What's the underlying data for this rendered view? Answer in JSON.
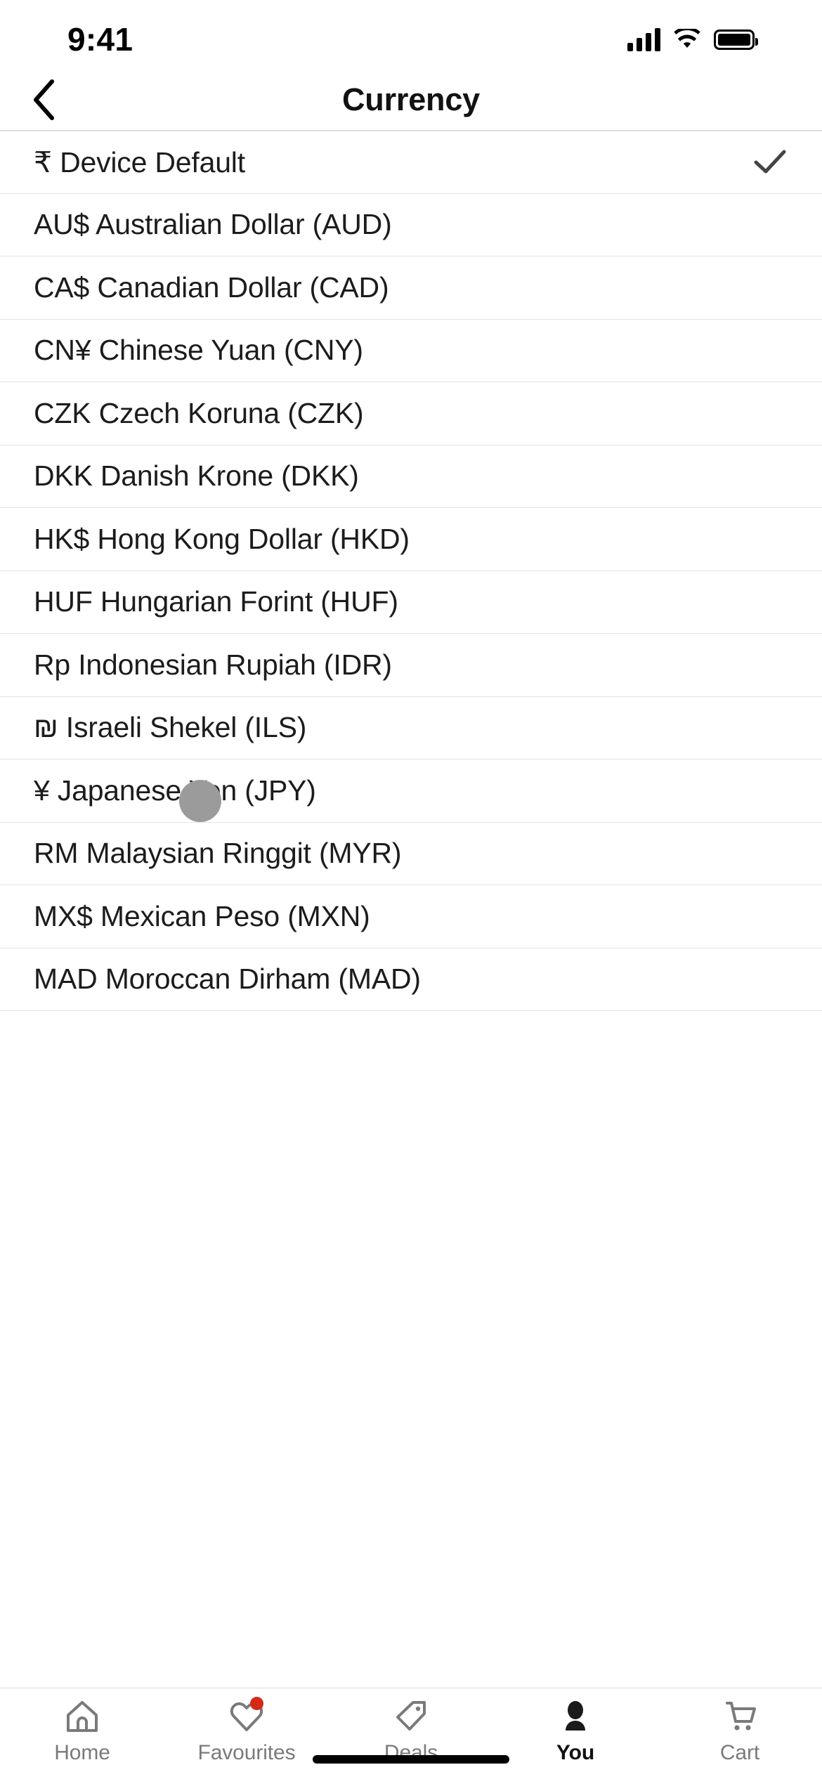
{
  "status_bar": {
    "time": "9:41",
    "icons": [
      "cellular-signal-icon",
      "wifi-icon",
      "battery-icon"
    ]
  },
  "header": {
    "title": "Currency",
    "back_icon": "chevron-left-icon"
  },
  "list": {
    "selected_index": 0,
    "check_icon": "checkmark-icon",
    "items": [
      {
        "label": "₹ Device Default",
        "symbol": "₹",
        "name": "Device Default",
        "code": "",
        "selected": true
      },
      {
        "label": "AU$ Australian Dollar (AUD)",
        "symbol": "AU$",
        "name": "Australian Dollar",
        "code": "AUD",
        "selected": false
      },
      {
        "label": "CA$ Canadian Dollar (CAD)",
        "symbol": "CA$",
        "name": "Canadian Dollar",
        "code": "CAD",
        "selected": false
      },
      {
        "label": "CN¥ Chinese Yuan (CNY)",
        "symbol": "CN¥",
        "name": "Chinese Yuan",
        "code": "CNY",
        "selected": false
      },
      {
        "label": "CZK Czech Koruna (CZK)",
        "symbol": "CZK",
        "name": "Czech Koruna",
        "code": "CZK",
        "selected": false
      },
      {
        "label": "DKK Danish Krone (DKK)",
        "symbol": "DKK",
        "name": "Danish Krone",
        "code": "DKK",
        "selected": false
      },
      {
        "label": "HK$ Hong Kong Dollar (HKD)",
        "symbol": "HK$",
        "name": "Hong Kong Dollar",
        "code": "HKD",
        "selected": false
      },
      {
        "label": "HUF Hungarian Forint (HUF)",
        "symbol": "HUF",
        "name": "Hungarian Forint",
        "code": "HUF",
        "selected": false
      },
      {
        "label": "Rp Indonesian Rupiah (IDR)",
        "symbol": "Rp",
        "name": "Indonesian Rupiah",
        "code": "IDR",
        "selected": false
      },
      {
        "label": "₪ Israeli Shekel (ILS)",
        "symbol": "₪",
        "name": "Israeli Shekel",
        "code": "ILS",
        "selected": false
      },
      {
        "label": "¥ Japanese Yen (JPY)",
        "symbol": "¥",
        "name": "Japanese Yen",
        "code": "JPY",
        "selected": false
      },
      {
        "label": "RM Malaysian Ringgit (MYR)",
        "symbol": "RM",
        "name": "Malaysian Ringgit",
        "code": "MYR",
        "selected": false
      },
      {
        "label": "MX$ Mexican Peso (MXN)",
        "symbol": "MX$",
        "name": "Mexican Peso",
        "code": "MXN",
        "selected": false
      },
      {
        "label": "MAD Moroccan Dirham (MAD)",
        "symbol": "MAD",
        "name": "Moroccan Dirham",
        "code": "MAD",
        "selected": false
      }
    ]
  },
  "tabbar": {
    "active": "You",
    "items": [
      {
        "label": "Home",
        "icon": "home-icon",
        "badge": false,
        "active": false
      },
      {
        "label": "Favourites",
        "icon": "heart-icon",
        "badge": true,
        "active": false
      },
      {
        "label": "Deals",
        "icon": "tag-icon",
        "badge": false,
        "active": false
      },
      {
        "label": "You",
        "icon": "person-icon",
        "badge": false,
        "active": true
      },
      {
        "label": "Cart",
        "icon": "shopping-cart-icon",
        "badge": false,
        "active": false
      }
    ]
  },
  "colors": {
    "badge_red": "#d42a17",
    "active_tab": "#111111",
    "inactive_tab": "#7a7a7a",
    "separator": "#e3e3e3",
    "cursor": "#9b9b9b"
  }
}
